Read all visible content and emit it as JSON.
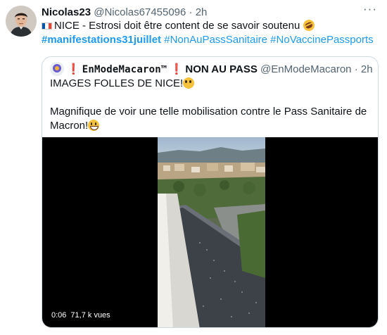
{
  "tweet": {
    "author_name": "Nicolas23",
    "author_handle": "@Nicolas67455096",
    "separator": "·",
    "time": "2h",
    "more_label": "···",
    "text_prefix": "NICE - Estrosi doit être content de se savoir soutenu",
    "flag_colors": [
      "#0055A4",
      "#FFFFFF",
      "#EF4135"
    ],
    "hashtags": [
      "#manifestations31juillet",
      "#NonAuPassSanitaire",
      "#NoVaccinePassports"
    ],
    "icons": {
      "avatar": "man-portrait",
      "flag": "france-flag",
      "emoji": "rofl-emoji"
    }
  },
  "quote": {
    "avatar_icon": "emblem-avatar",
    "exclamation": "❗",
    "name_mono": "EnModeMacaron™",
    "name_rest": "NON AU PASS",
    "handle": "@EnModeMacaron",
    "separator": "·",
    "time": "2h",
    "line1": "IMAGES FOLLES DE NICE!",
    "line2": "Magnifique de voir une telle mobilisation contre le Pass Sanitaire de Macron!",
    "icons": {
      "line1_emoji": "flushed-face-emoji",
      "line2_emoji": "grinning-squinting-emoji"
    }
  },
  "video": {
    "duration": "0:06",
    "views": "71,7 k vues"
  },
  "colors": {
    "link": "#1d9bf0",
    "secondary_text": "#536471",
    "border": "#cfd9de"
  }
}
